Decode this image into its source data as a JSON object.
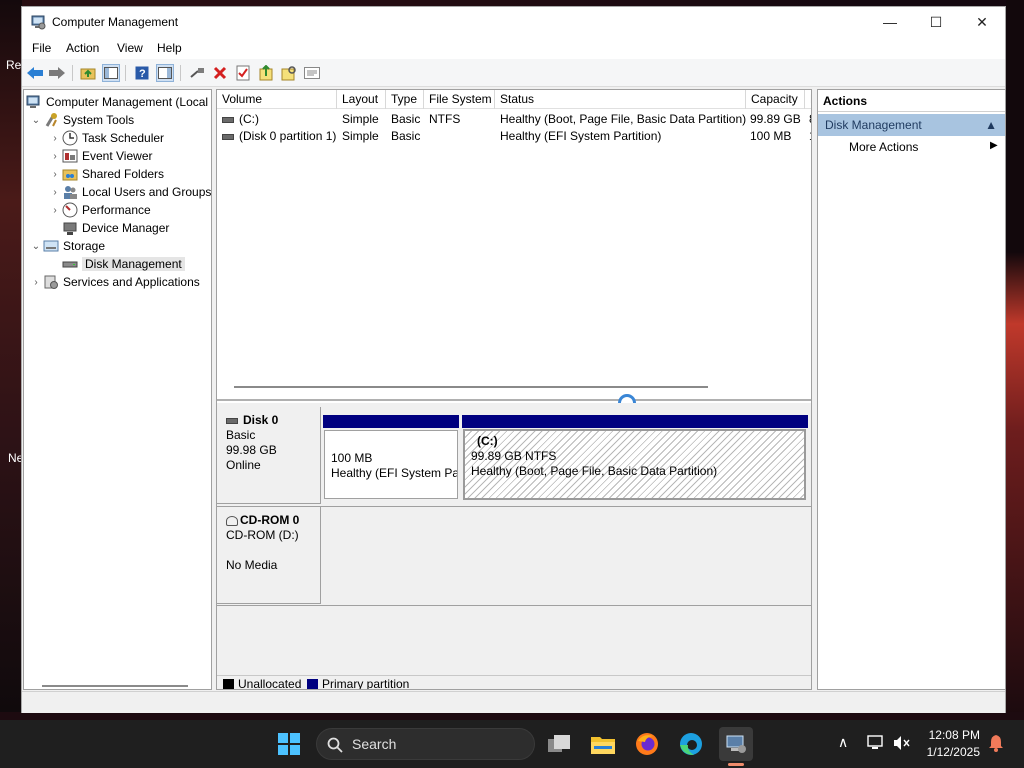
{
  "desktop": {
    "edge_label_1": "Re",
    "edge_label_2": "Ne"
  },
  "window": {
    "title": "Computer Management",
    "controls": {
      "minimize": "—",
      "maximize": "☐",
      "close": "✕"
    }
  },
  "menu": [
    "File",
    "Action",
    "View",
    "Help"
  ],
  "tree": {
    "root": "Computer Management (Local",
    "system_tools": "System Tools",
    "task_scheduler": "Task Scheduler",
    "event_viewer": "Event Viewer",
    "shared_folders": "Shared Folders",
    "local_users": "Local Users and Groups",
    "performance": "Performance",
    "device_manager": "Device Manager",
    "storage": "Storage",
    "disk_management": "Disk Management",
    "services_apps": "Services and Applications"
  },
  "volumes": {
    "headers": [
      "Volume",
      "Layout",
      "Type",
      "File System",
      "Status",
      "Capacity",
      "F"
    ],
    "rows": [
      {
        "volume": "(C:)",
        "layout": "Simple",
        "type": "Basic",
        "fs": "NTFS",
        "status": "Healthy (Boot, Page File, Basic Data Partition)",
        "capacity": "99.89 GB",
        "free": "8"
      },
      {
        "volume": "(Disk 0 partition 1)",
        "layout": "Simple",
        "type": "Basic",
        "fs": "",
        "status": "Healthy (EFI System Partition)",
        "capacity": "100 MB",
        "free": "1"
      }
    ]
  },
  "disks": {
    "disk0": {
      "name": "Disk 0",
      "type": "Basic",
      "size": "99.98 GB",
      "state": "Online",
      "part1": {
        "size": "100 MB",
        "status": "Healthy (EFI System Par"
      },
      "part2": {
        "label": "(C:)",
        "size": "99.89 GB NTFS",
        "status": "Healthy (Boot, Page File, Basic Data Partition)"
      }
    },
    "cdrom0": {
      "name": "CD-ROM 0",
      "drive": "CD-ROM (D:)",
      "media": "No Media"
    }
  },
  "legend": {
    "unallocated": "Unallocated",
    "primary": "Primary partition",
    "unallocated_color": "#000000",
    "primary_color": "#000080"
  },
  "actions": {
    "header": "Actions",
    "section": "Disk Management",
    "more": "More Actions"
  },
  "taskbar": {
    "search_label": "Search",
    "time": "12:08 PM",
    "date": "1/12/2025"
  }
}
